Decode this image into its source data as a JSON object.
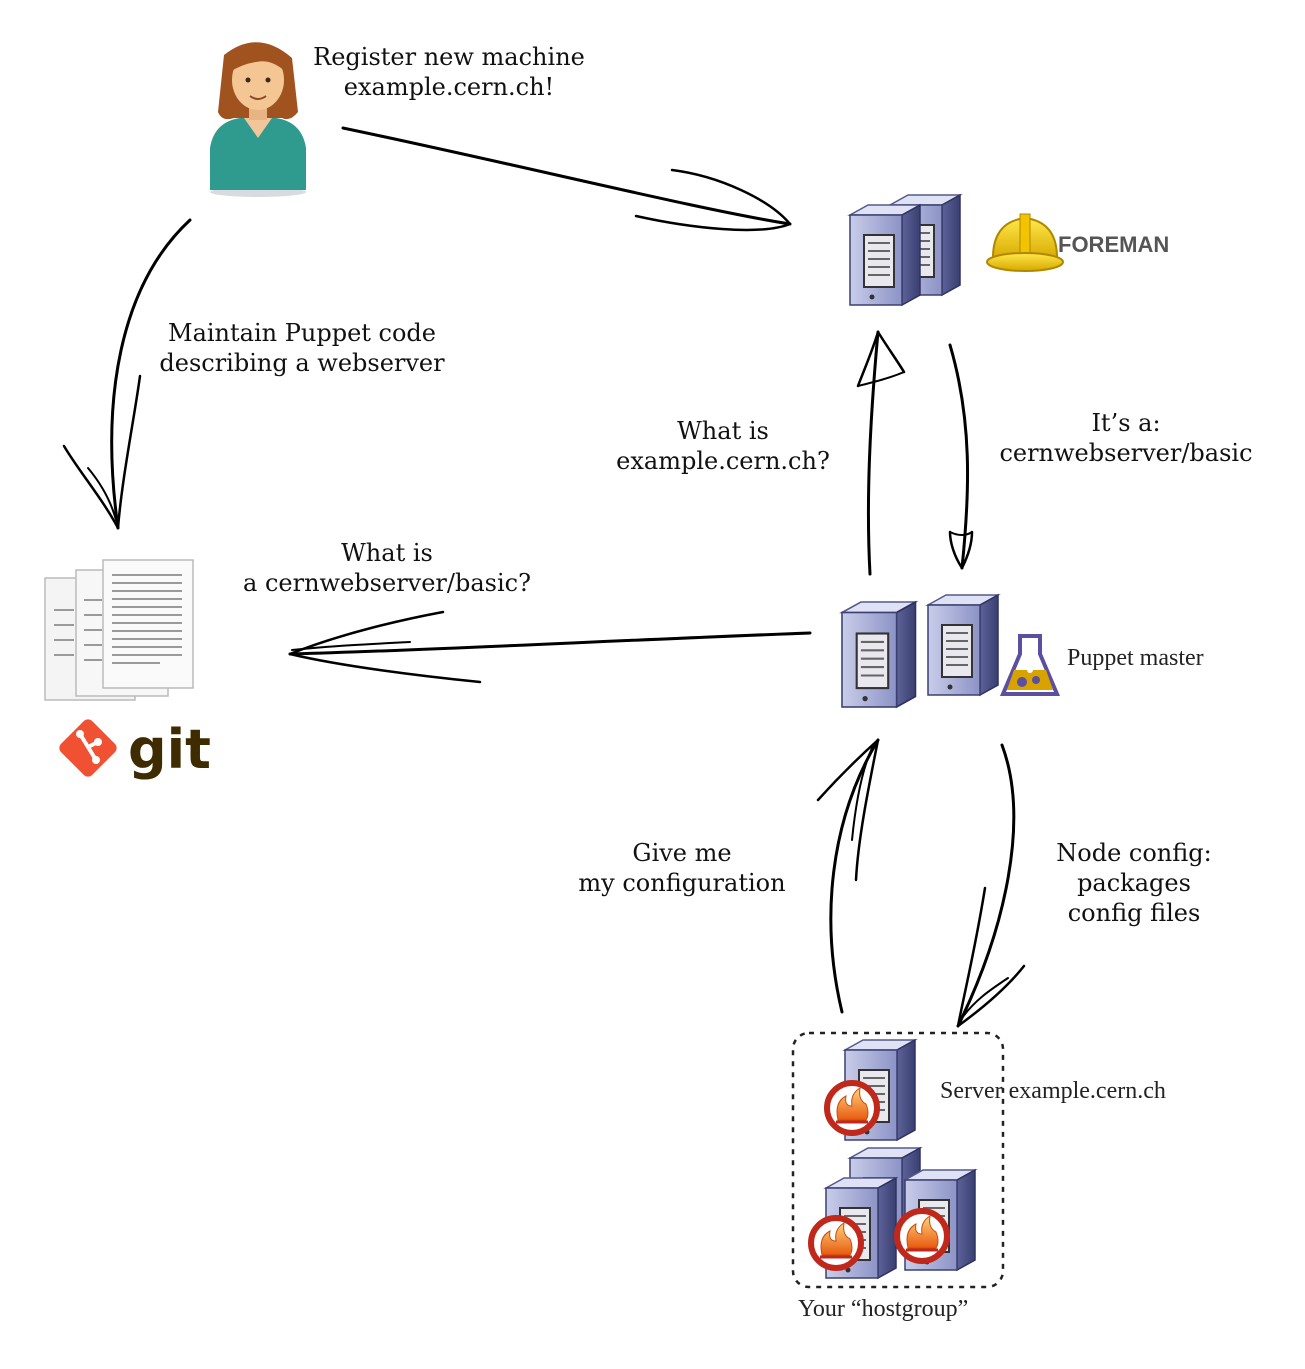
{
  "labels": {
    "register": [
      "Register new machine",
      "example.cern.ch!"
    ],
    "maintain": [
      "Maintain Puppet code",
      "describing a webserver"
    ],
    "what_is_host": [
      "What is",
      "example.cern.ch?"
    ],
    "its_a": [
      "It’s a:",
      "cernwebserver/basic"
    ],
    "what_is_class": [
      "What is",
      "a cernwebserver/basic?"
    ],
    "give_me": [
      "Give me",
      "my configuration"
    ],
    "node_config": [
      "Node config:",
      "packages",
      "config files"
    ],
    "puppet_master": "Puppet master",
    "server": "Server example.cern.ch",
    "hostgroup": "Your “hostgroup”"
  },
  "logos": {
    "foreman": "FOREMAN",
    "git": "git"
  },
  "icons": [
    "user-avatar-icon",
    "server-icon",
    "foreman-helmet-icon",
    "puppet-flask-icon",
    "git-logo-icon",
    "documents-icon",
    "fire-badge-icon"
  ],
  "colors": {
    "git_orange": "#f05133",
    "git_text": "#3e2c00",
    "helmet_yellow": "#f5d000",
    "server_blue": "#8e95c8",
    "puppet_purple": "#5b4fa0",
    "avatar_shirt": "#2f9a8e",
    "avatar_hair": "#a0521f"
  }
}
